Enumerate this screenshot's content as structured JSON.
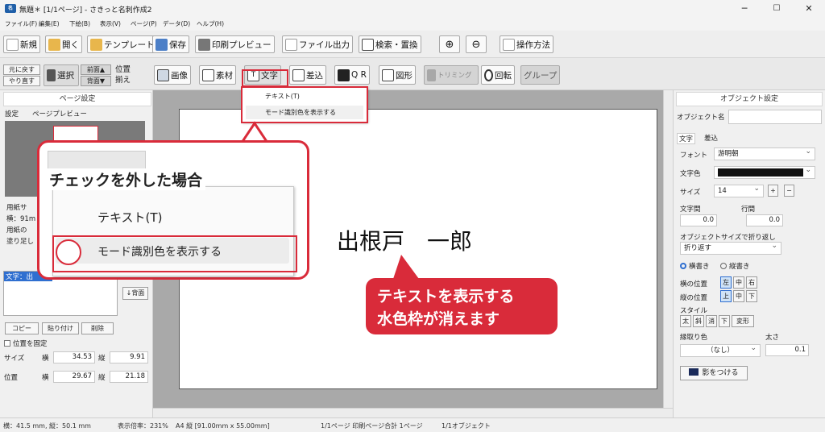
{
  "window": {
    "title": "無題＊ [1/1ページ] - さきっと名刺作成2",
    "minimize": "─",
    "maximize": "☐",
    "close": "✕"
  },
  "menu": [
    "ファイル(F)",
    "編集(E)",
    "下絵(B)",
    "表示(V)",
    "ページ(P)",
    "データ(D)",
    "ヘルプ(H)"
  ],
  "toolbar1": {
    "new": "新規",
    "open": "開く",
    "template": "テンプレート",
    "save": "保存",
    "print_preview": "印刷プレビュー",
    "file_output": "ファイル出力",
    "search_replace": "検索・置換",
    "zoom_in": "⊕",
    "zoom_out": "⊖",
    "help": "操作方法"
  },
  "toolbar2": {
    "undo": "元に戻す",
    "redo": "やり直す",
    "select": "選択",
    "front": "前面▲",
    "back": "背面▼",
    "align": "位置",
    "align2": "揃え",
    "image": "画像",
    "material": "素材",
    "text": "文字",
    "merge": "差込",
    "qr": "Q R",
    "shape": "図形",
    "trim": "トリミング",
    "rotate": "回転",
    "group": "グループ"
  },
  "dropdown": {
    "item1": "テキスト(T)",
    "item2": "モード識別色を表示する"
  },
  "left": {
    "header": "ページ設定",
    "tab_settings": "設定",
    "tab_preview": "ページプレビュー",
    "paper_size": "用紙サ",
    "width_label": "横：91m",
    "paper_line": "用紙の",
    "bleed": "塗り足し",
    "list_item": "文字：出",
    "back_button": "↓背面",
    "copy": "コピー",
    "paste": "貼り付け",
    "delete": "削除",
    "lock": "位置を固定",
    "size": "サイズ",
    "horiz": "横",
    "vert": "縦",
    "size_w": "34.53",
    "size_h": "9.91",
    "position": "位置",
    "pos_x": "29.67",
    "pos_y": "21.18"
  },
  "canvas": {
    "name_text": "出根戸　一郎"
  },
  "callout": {
    "title": "チェックを外した場合",
    "item1": "テキスト(T)",
    "item2": "モード識別色を表示する"
  },
  "callout2": {
    "line1": "テキストを表示する",
    "line2": "水色枠が消えます"
  },
  "right": {
    "header": "オブジェクト設定",
    "object_name": "オブジェクト名",
    "tab_text": "文字",
    "tab_merge": "差込",
    "font_label": "フォント",
    "font_value": "游明朝",
    "color_label": "文字色",
    "size_label": "サイズ",
    "size_value": "14",
    "plus": "+",
    "minus": "−",
    "char_spacing": "文字間",
    "char_spacing_value": "0.0",
    "line_spacing": "行間",
    "line_spacing_value": "0.0",
    "wrap_label": "オブジェクトサイズで折り返し",
    "wrap_value": "折り返す",
    "horizontal_write": "横書き",
    "vertical_write": "縦書き",
    "h_position": "横の位置",
    "h_left": "左",
    "h_center": "中",
    "h_right": "右",
    "v_position": "縦の位置",
    "v_top": "上",
    "v_middle": "中",
    "v_bottom": "下",
    "style": "スタイル",
    "bold": "太",
    "italic": "斜",
    "strike": "消",
    "underline": "下",
    "transform": "変形",
    "outline_color": "縁取り色",
    "outline_value": "（なし）",
    "thickness": "太さ",
    "thickness_value": "0.1",
    "shadow": "影をつける"
  },
  "status": {
    "coords": "横：41.5 mm, 縦：50.1 mm",
    "zoom": "表示倍率：231%",
    "paper": "A4 縦 [91.00mm x 55.00mm]",
    "pages": "1/1ページ 印刷ページ合計 1ページ",
    "objects": "1/1オブジェクト"
  },
  "colors": {
    "accent": "#d92b3a",
    "icon_blue": "#1f5fa8",
    "highlight": "#cfe3f7"
  }
}
